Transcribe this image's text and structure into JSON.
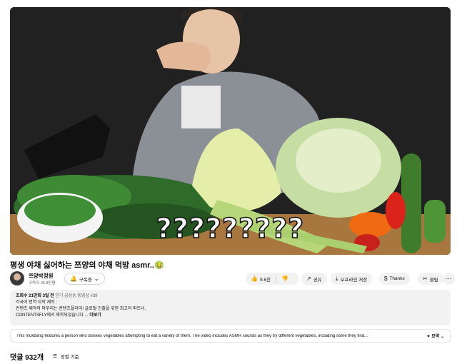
{
  "video": {
    "overlay_caption": "?????????"
  },
  "title": "평생 야채 싫어하는 쯔양의 야채 먹방 asmr..🤢",
  "channel": {
    "name": "쯔양박정원",
    "subscribers": "구독자 36.8만명",
    "subscribe_label": "구독중",
    "bell_icon": "bell-icon",
    "chevron_icon": "chevron-down-icon"
  },
  "actions": {
    "like_count": "9.6천",
    "share_label": "공유",
    "offline_label": "오프라인 저장",
    "thanks_label": "Thanks",
    "clip_label": "클립"
  },
  "description": {
    "views": "조회수 21만회",
    "ago": "3일 전",
    "tag": "인기 급상승 동영상 #39",
    "line1": "각국어 번역 자막 제작 :",
    "line2": "컨텐츠 제작의 마무리는 컨텐츠플라이! 글로벌 진출을 위한 최고의 파트너,",
    "line3": "CONTENTSFLY에서 제작되었습니다",
    "ellipsis": "...",
    "more": "더보기"
  },
  "summary": {
    "text": "This mukbang features a person who dislikes vegetables attempting to eat a variety of them. The video includes ASMR sounds as they try different vegetables, including some they find...",
    "button": "요약"
  },
  "comments": {
    "count_label": "댓글 932개",
    "sort_label": "정렬 기준"
  },
  "colors": {
    "accent_green": "#8cc63f",
    "pill_bg": "#f2f2f2"
  }
}
